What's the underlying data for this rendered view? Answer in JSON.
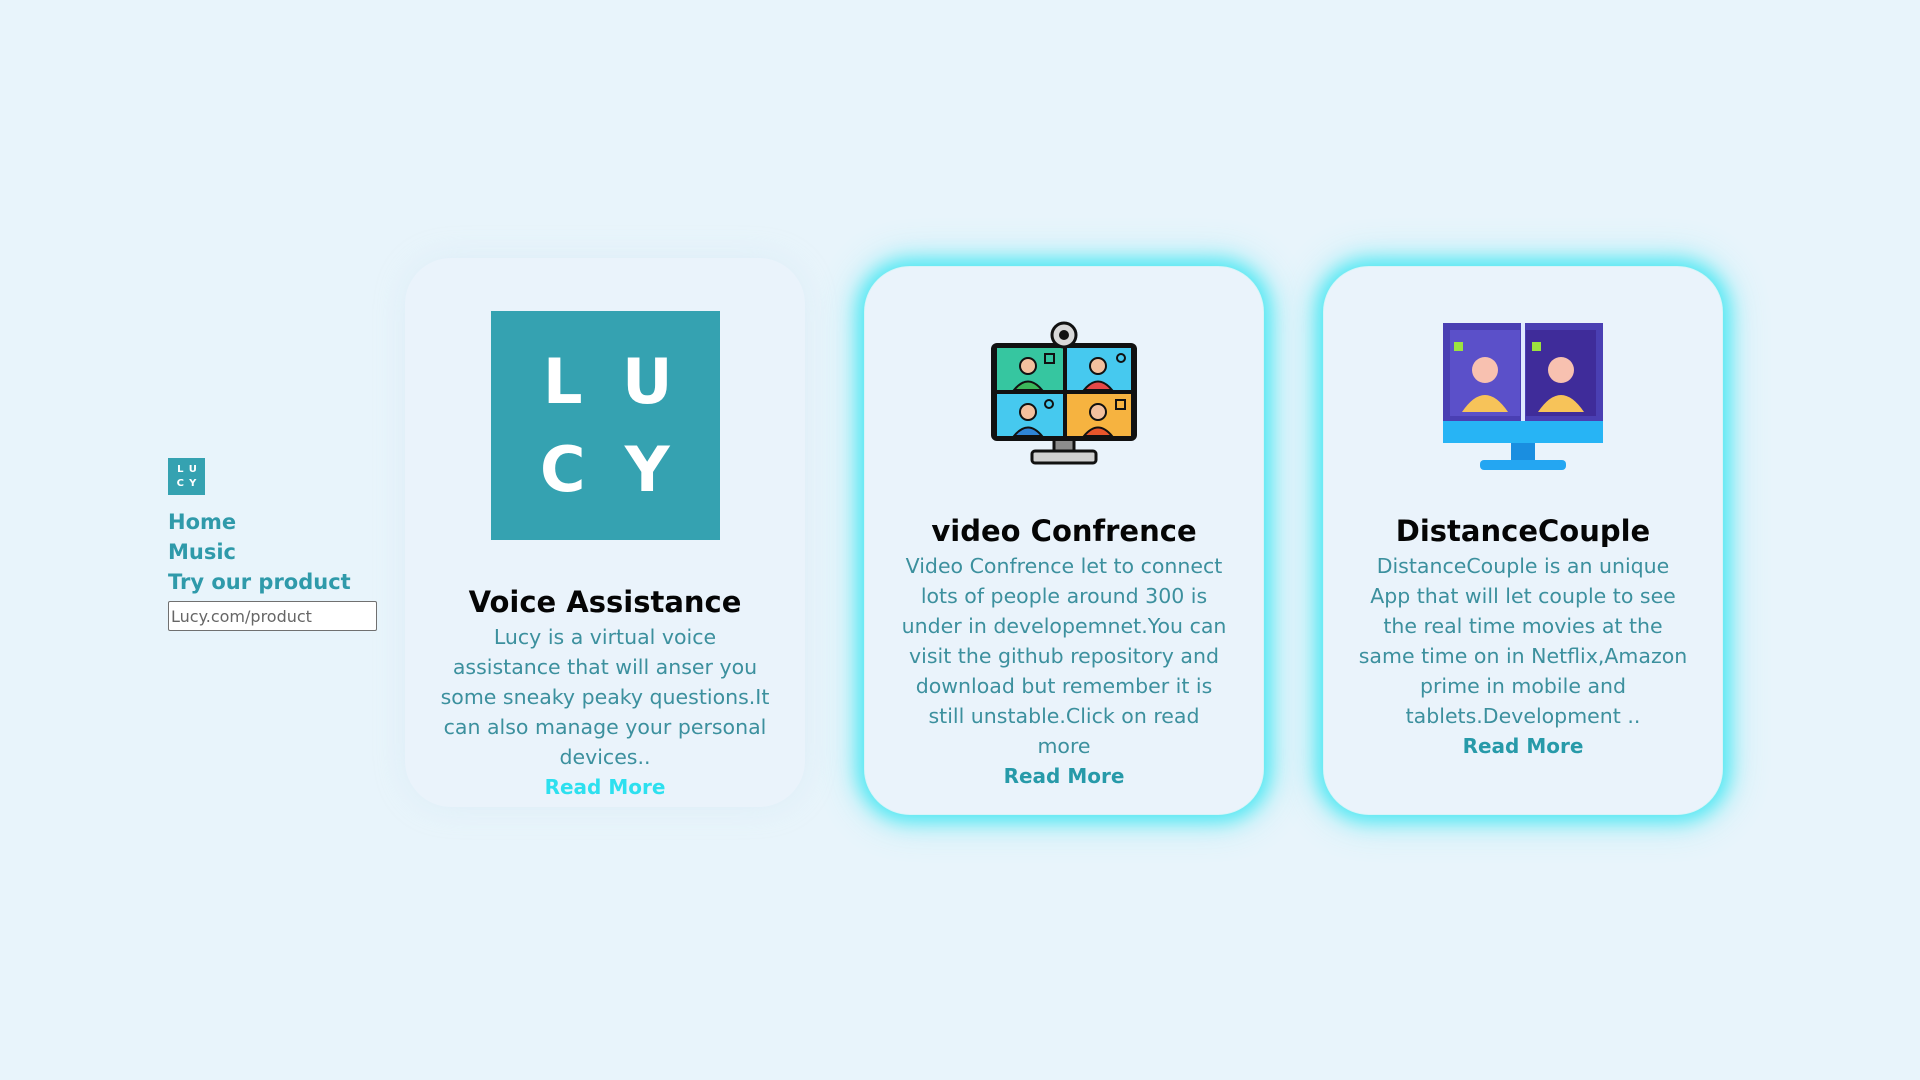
{
  "sidebar": {
    "logo_letters": [
      "L",
      "U",
      "C",
      "Y"
    ],
    "nav": [
      {
        "label": "Home"
      },
      {
        "label": "Music"
      },
      {
        "label": "Try our product"
      }
    ],
    "product_input": {
      "value": "Lucy.com/product",
      "placeholder": ""
    }
  },
  "cards": [
    {
      "icon": "lucy-logo",
      "logo_letters": [
        "L",
        "U",
        "C",
        "Y"
      ],
      "title": "Voice Assistance",
      "text": "Lucy is a virtual voice assistance that will anser you some sneaky peaky questions.It can also manage your personal devices..",
      "link": "Read More"
    },
    {
      "icon": "video-conference-icon",
      "title": "video Confrence",
      "text": "Video Confrence let to connect lots of people around 300 is under in developemnet.You can visit the github repository and download but remember it is still unstable.Click on read more",
      "link": "Read More"
    },
    {
      "icon": "distance-couple-icon",
      "title": "DistanceCouple",
      "text": "DistanceCouple is an unique App that will let couple to see the real time movies at the same time on in Netflix,Amazon prime in mobile and tablets.Development ..",
      "link": "Read More"
    }
  ],
  "colors": {
    "background": "#e8f4fb",
    "brand": "#35a2b1",
    "glow": "#52e8f3",
    "link_active": "#2de0ef"
  }
}
